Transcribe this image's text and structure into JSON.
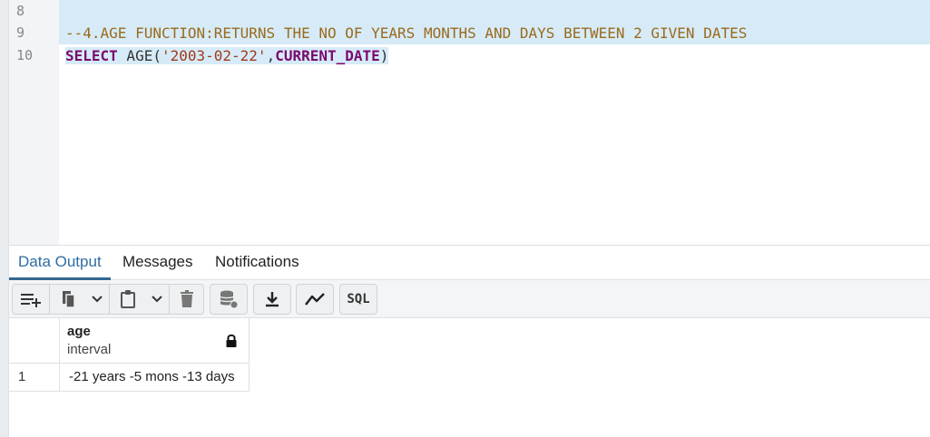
{
  "editor": {
    "line_numbers": [
      "8",
      "9",
      "10"
    ],
    "line9": {
      "comment": "--4.AGE FUNCTION:RETURNS THE NO OF YEARS MONTHS AND DAYS BETWEEN 2 GIVEN DATES"
    },
    "line10": {
      "kw_select": "SELECT",
      "fn_age": " AGE",
      "open": "(",
      "str_date": "'2003-02-22'",
      "comma": ",",
      "kw_current": "CURRENT_DATE",
      "close": ")"
    }
  },
  "tabs": [
    {
      "label": "Data Output",
      "active": true
    },
    {
      "label": "Messages",
      "active": false
    },
    {
      "label": "Notifications",
      "active": false
    }
  ],
  "toolbar": {
    "sql_label": "SQL",
    "icons": [
      "add-row-icon",
      "copy-icon",
      "chevron-down-icon",
      "paste-icon",
      "chevron-down-icon",
      "delete-icon",
      "save-data-icon",
      "download-icon",
      "graph-icon",
      "sql-icon"
    ]
  },
  "grid": {
    "columns": [
      {
        "name": "age",
        "type": "interval",
        "locked": true
      }
    ],
    "rows": [
      {
        "num": "1",
        "values": [
          "-21 years -5 mons -13 days"
        ]
      }
    ]
  },
  "colors": {
    "accent": "#2e6da4",
    "selection": "#d6ebf7",
    "keyword": "#7a0a6e",
    "comment": "#9a6a1c"
  }
}
